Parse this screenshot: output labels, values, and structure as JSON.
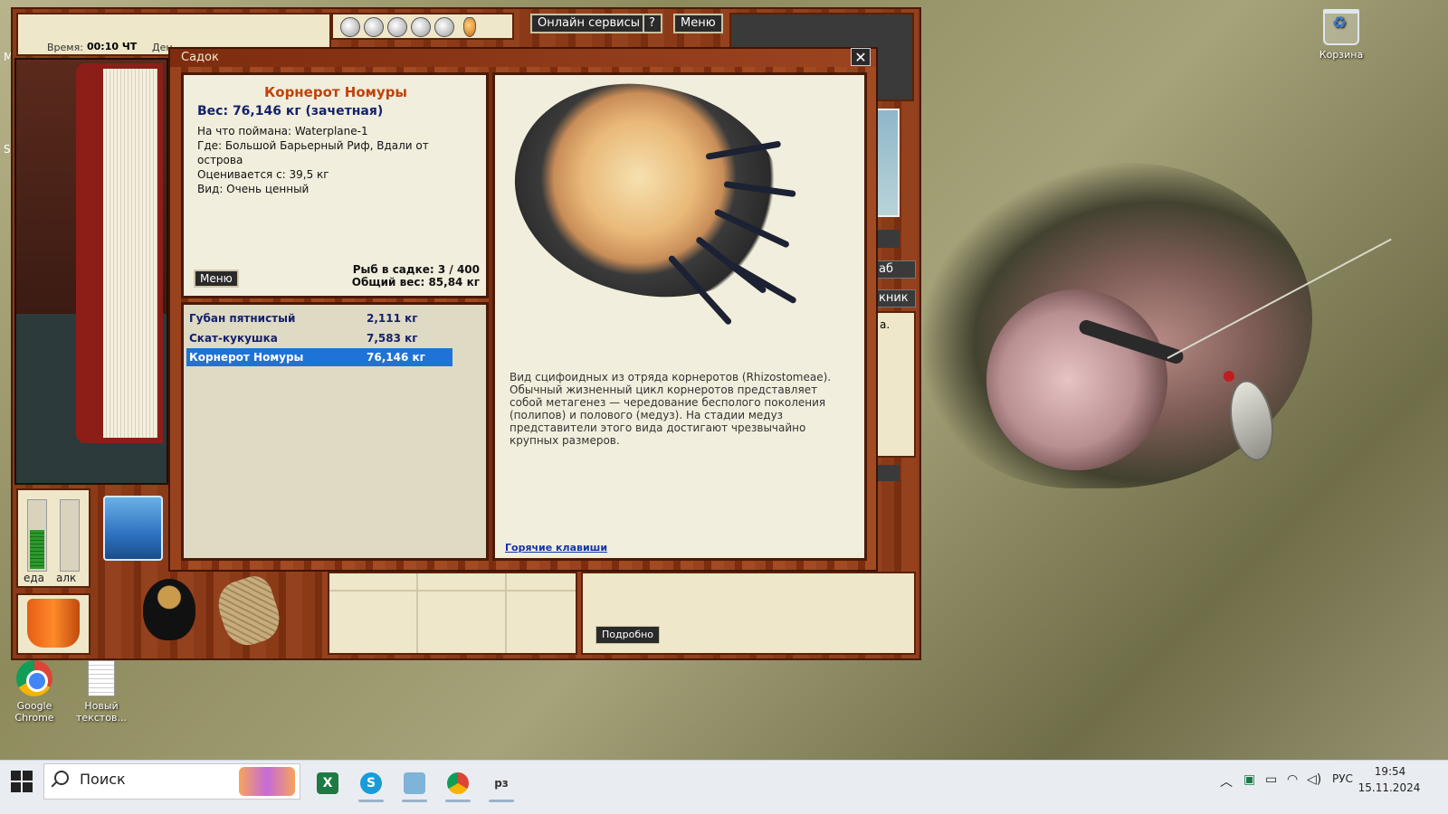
{
  "desktop": {
    "icons": [
      {
        "label": "Корзина"
      },
      {
        "label": "Google Chrome"
      },
      {
        "label": "Новый текстов..."
      }
    ],
    "edge_fragments": [
      "М",
      "S"
    ]
  },
  "game": {
    "time_label": "Время:",
    "time_value": "00:10 ЧТ",
    "day_label": "Ден",
    "lamps_total": 6,
    "online_services_label": "Онлайн сервисы",
    "help_label": "?",
    "top_menu_label": "Меню",
    "right_tab_1": "аб",
    "right_tab_2": "кник",
    "right_panel_text": "а.",
    "meters": {
      "food_label": "еда",
      "alc_label": "алк",
      "food_level": 0.55,
      "alc_level": 0.0
    },
    "details_label": "Подробно"
  },
  "dialog": {
    "title": "Садок",
    "close_label": "✕",
    "fish_name": "Корнерот Номуры",
    "weight_line": "Вес: 76,146 кг (зачетная)",
    "bait_line": "На что поймана: Waterplane-1",
    "place_line_1": "Где: Большой Барьерный Риф, Вдали от",
    "place_line_2": "острова",
    "rated_line": "Оценивается с: 39,5 кг",
    "kind_line": "Вид: Очень ценный",
    "menu_label": "Меню",
    "count_line": "Рыб в садке: 3 / 400",
    "total_line": "Общий вес: 85,84 кг",
    "catch_list": [
      {
        "name": "Губан пятнистый",
        "weight": "2,111 кг",
        "selected": false
      },
      {
        "name": "Скат-кукушка",
        "weight": "7,583 кг",
        "selected": false
      },
      {
        "name": "Корнерот Номуры",
        "weight": "76,146 кг",
        "selected": true
      }
    ],
    "description": "Вид сцифоидных из отряда корнеротов (Rhizostomeae). Обычный жизненный цикл корнеротов представляет собой метагенез — чередование бесполого поколения (полипов) и полового (медуз). На стадии медуз представители этого вида достигают чрезвычайно крупных размеров.",
    "hotkeys_label": "Горячие клавиши"
  },
  "taskbar": {
    "search_placeholder": "Поиск",
    "lang": "РУС",
    "time": "19:54",
    "date": "15.11.2024"
  }
}
